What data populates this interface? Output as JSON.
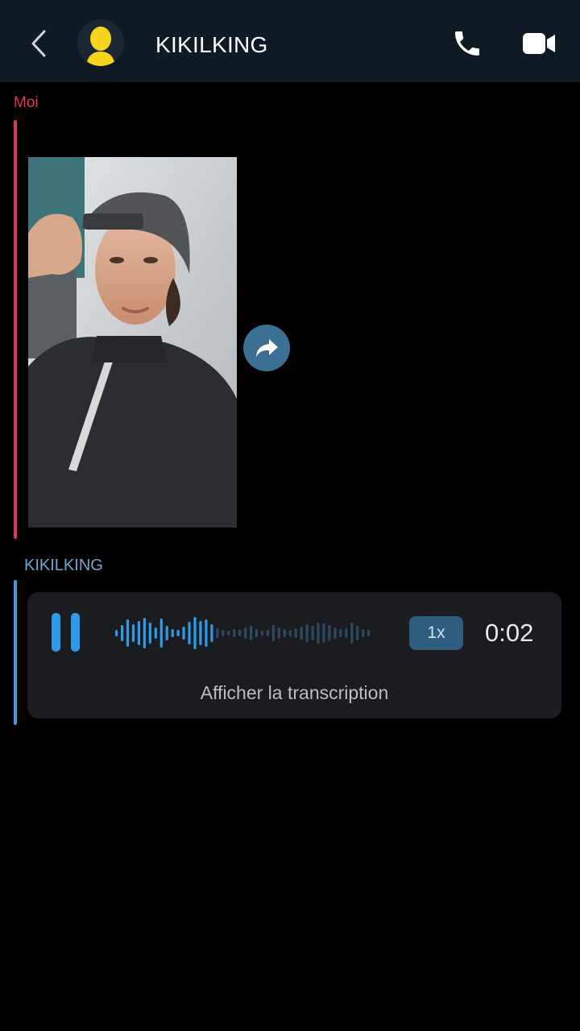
{
  "header": {
    "contact_name": "KIKILKING",
    "icons": [
      "back-icon",
      "bitmoji-avatar-icon",
      "phone-icon",
      "video-camera-icon"
    ]
  },
  "messages": {
    "me": {
      "sender_label": "Moi",
      "accent_color": "#e0365a",
      "content": "photo"
    },
    "them": {
      "sender_label": "KIKILKING",
      "accent_color": "#3b9ee0",
      "voice_note": {
        "speed_label": "1x",
        "duration": "0:02",
        "transcript_label": "Afficher la transcription",
        "played_fraction": 0.38
      }
    }
  },
  "colors": {
    "header_bg": "#0f1a24",
    "avatar_yellow": "#f6d41a",
    "share_button": "#3b6f94",
    "waveform_played": "#2f9be8",
    "waveform_unplayed": "#2d4a63"
  }
}
